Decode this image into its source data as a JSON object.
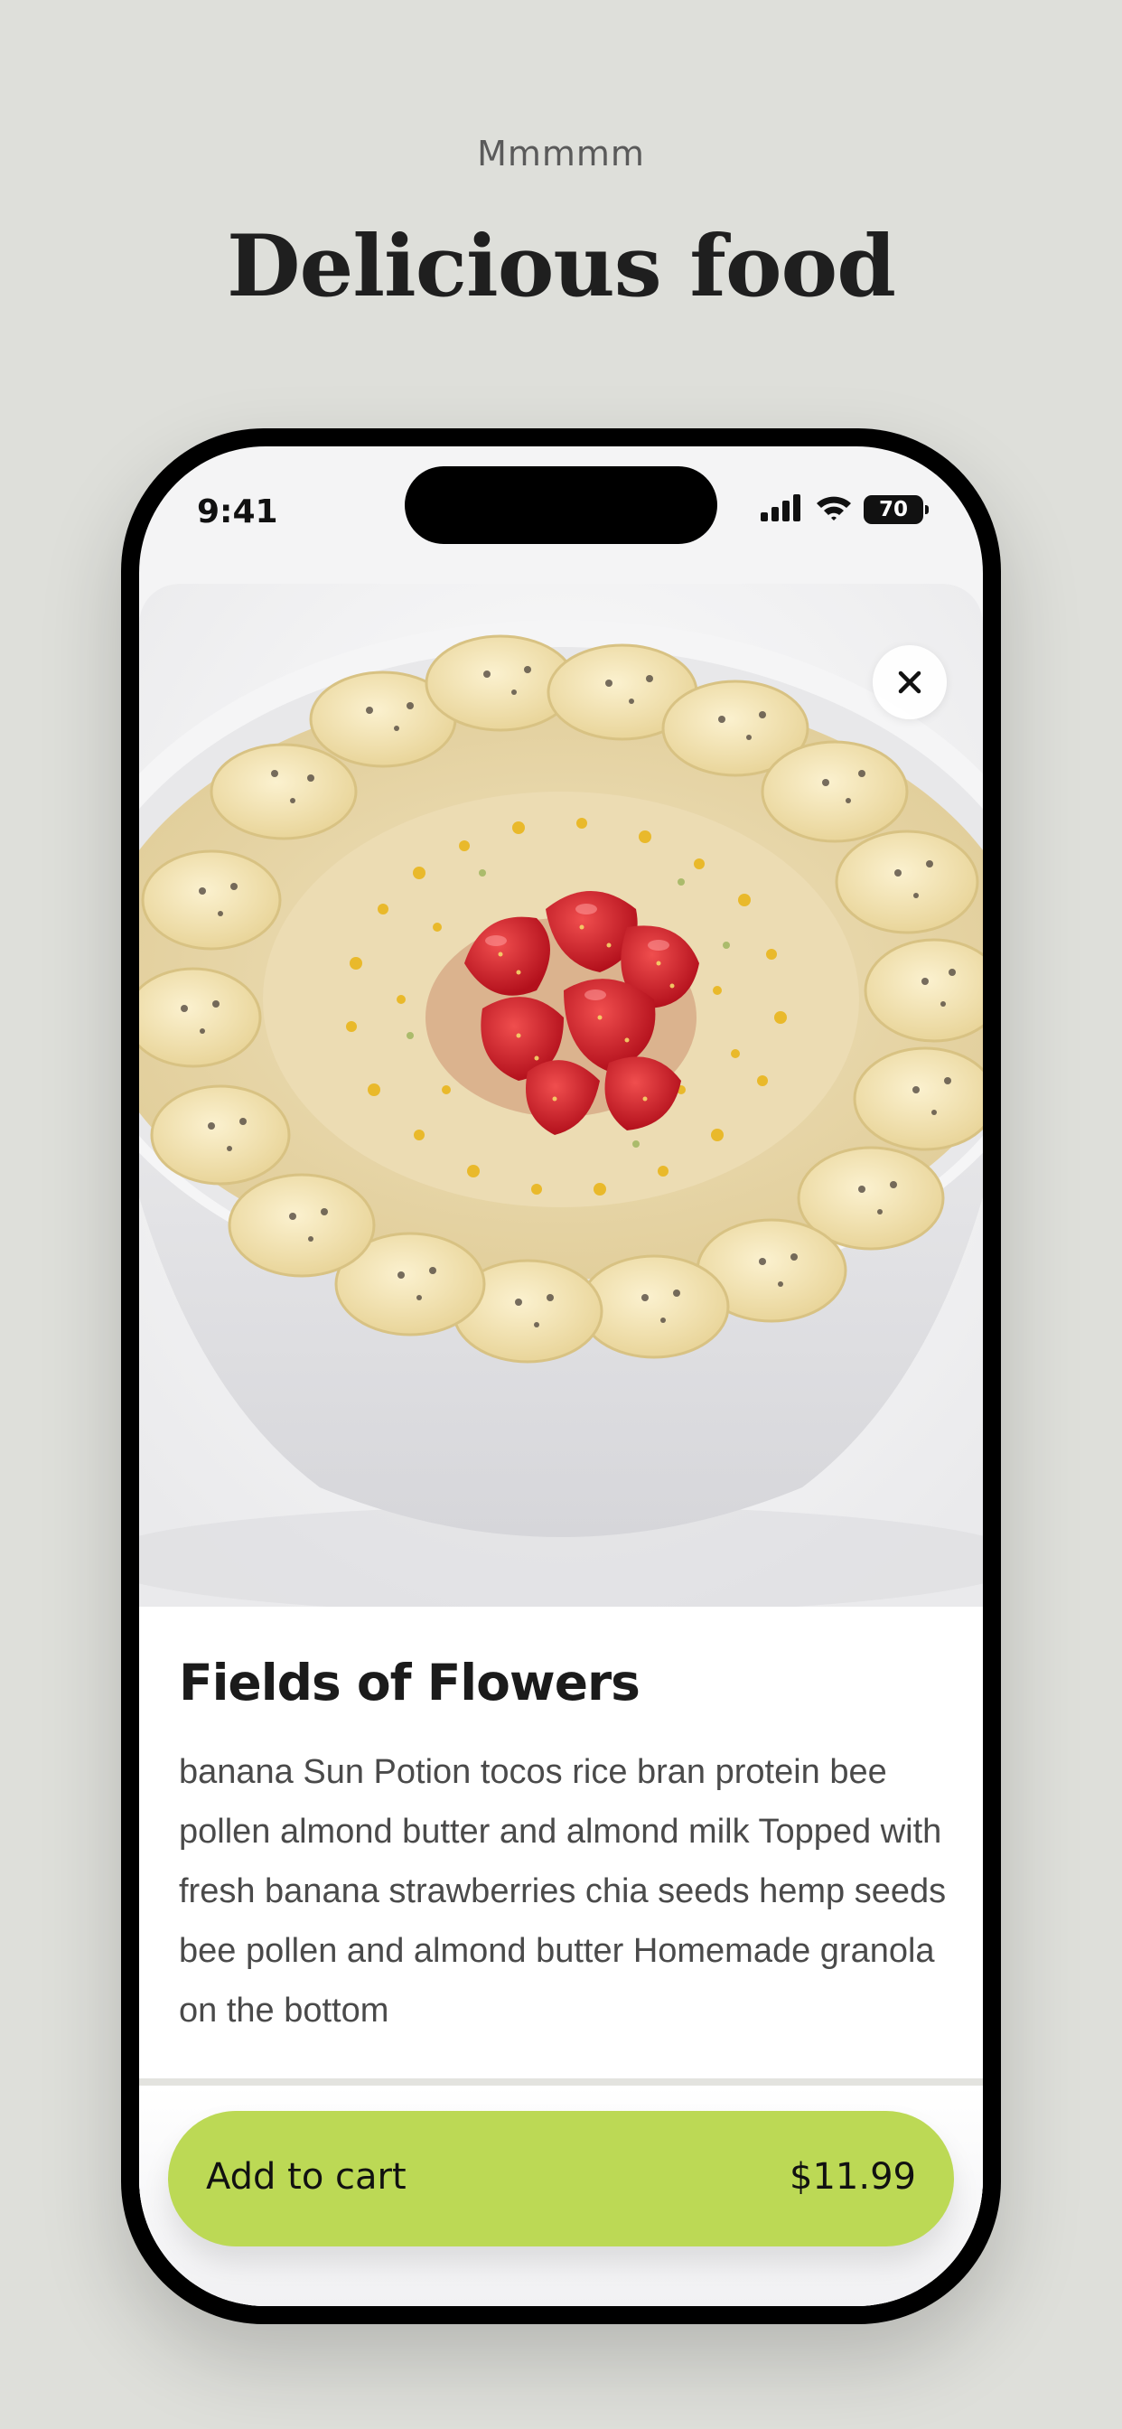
{
  "hero": {
    "eyebrow": "Mmmmm",
    "headline": "Delicious food"
  },
  "status_bar": {
    "time": "9:41",
    "battery_level": "70",
    "icons": [
      "signal-icon",
      "wifi-icon",
      "battery-icon"
    ]
  },
  "product": {
    "image": "acai-bowl-image",
    "title": "Fields of Flowers",
    "description": "banana Sun Potion tocos rice bran protein bee pollen almond butter and almond milk Topped with fresh banana strawberries chia seeds hemp seeds bee pollen and almond butter Homemade granola on the bottom"
  },
  "cta": {
    "label": "Add to cart",
    "price": "$11.99"
  },
  "colors": {
    "page_background": "#dedfda",
    "accent": "#bcd955",
    "title_text": "#1f1f1f",
    "body_text": "#4a4a4a"
  }
}
